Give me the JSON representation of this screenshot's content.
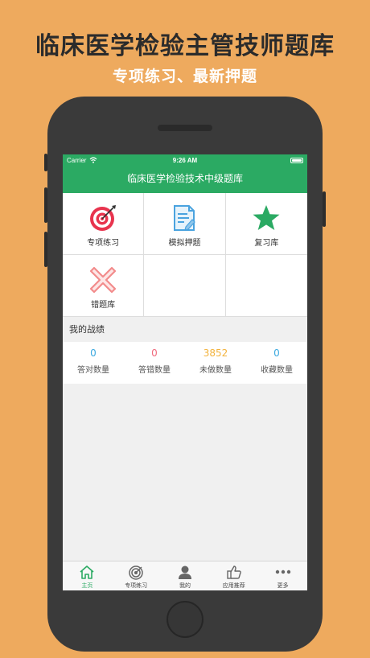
{
  "promo": {
    "title": "临床医学检验主管技师题库",
    "subtitle": "专项练习、最新押题"
  },
  "status_bar": {
    "carrier": "Carrier",
    "time": "9:26 AM"
  },
  "app": {
    "title": "临床医学检验技术中级题库"
  },
  "menu": [
    {
      "label": "专项练习",
      "icon": "target-icon"
    },
    {
      "label": "模拟押题",
      "icon": "exam-paper-icon"
    },
    {
      "label": "复习库",
      "icon": "star-icon"
    },
    {
      "label": "错题库",
      "icon": "wrong-x-icon"
    }
  ],
  "stats": {
    "section_title": "我的战绩",
    "items": [
      {
        "value": "0",
        "label": "答对数量",
        "color": "#3aa9e0"
      },
      {
        "value": "0",
        "label": "答错数量",
        "color": "#f06a7d"
      },
      {
        "value": "3852",
        "label": "未做数量",
        "color": "#f3b33d"
      },
      {
        "value": "0",
        "label": "收藏数量",
        "color": "#3aa9e0"
      }
    ]
  },
  "tabs": [
    {
      "label": "主页",
      "icon": "home-icon",
      "active": true
    },
    {
      "label": "专项练习",
      "icon": "target-icon",
      "active": false
    },
    {
      "label": "我的",
      "icon": "user-icon",
      "active": false
    },
    {
      "label": "应用推荐",
      "icon": "thumbs-up-icon",
      "active": false
    },
    {
      "label": "更多",
      "icon": "more-dots-icon",
      "active": false
    }
  ],
  "colors": {
    "background": "#eeaa5e",
    "accent_green": "#2baa63",
    "target_red": "#e8344e",
    "wrong_pink": "#f28b8b",
    "doc_blue": "#4aa3df"
  }
}
